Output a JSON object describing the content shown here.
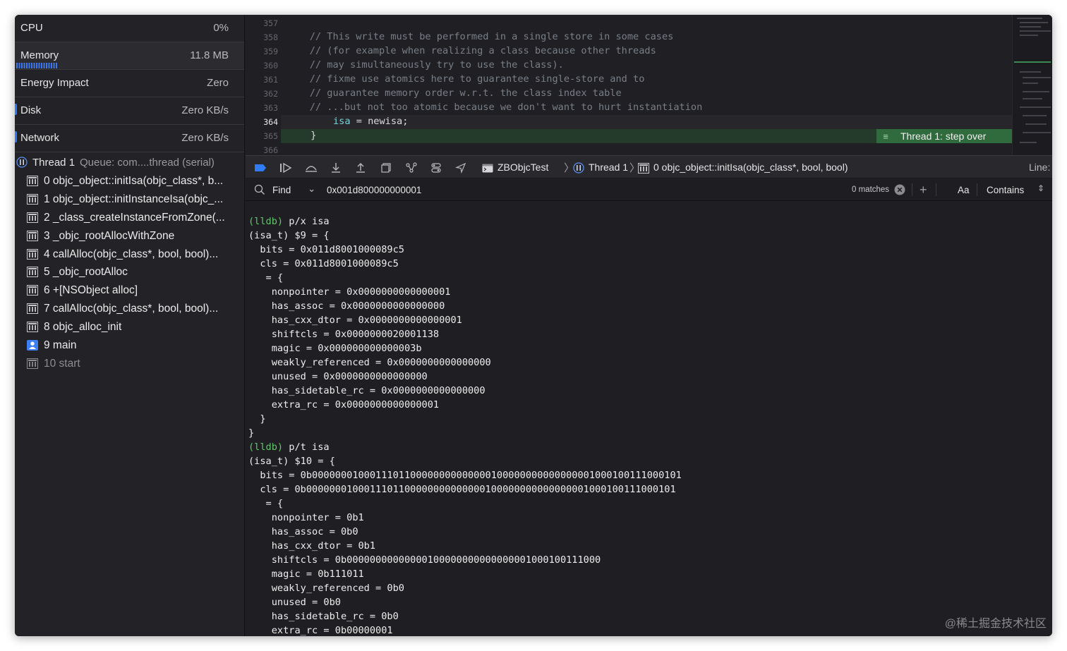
{
  "gauges": [
    {
      "label": "CPU",
      "value": "0%"
    },
    {
      "label": "Memory",
      "value": "11.8 MB"
    },
    {
      "label": "Energy Impact",
      "value": "Zero"
    },
    {
      "label": "Disk",
      "value": "Zero KB/s"
    },
    {
      "label": "Network",
      "value": "Zero KB/s"
    }
  ],
  "thread": {
    "name": "Thread 1",
    "queue": "Queue: com....thread (serial)"
  },
  "frames": [
    {
      "label": "0 objc_object::initIsa(objc_class*, b...",
      "icon": "library-icon"
    },
    {
      "label": "1 objc_object::initInstanceIsa(objc_...",
      "icon": "library-icon"
    },
    {
      "label": "2 _class_createInstanceFromZone(...",
      "icon": "library-icon"
    },
    {
      "label": "3 _objc_rootAllocWithZone",
      "icon": "library-icon"
    },
    {
      "label": "4 callAlloc(objc_class*, bool, bool)...",
      "icon": "library-icon"
    },
    {
      "label": "5 _objc_rootAlloc",
      "icon": "library-icon"
    },
    {
      "label": "6 +[NSObject alloc]",
      "icon": "library-icon"
    },
    {
      "label": "7 callAlloc(objc_class*, bool, bool)...",
      "icon": "library-icon"
    },
    {
      "label": "8 objc_alloc_init",
      "icon": "library-icon"
    },
    {
      "label": "9 main",
      "icon": "user-icon"
    },
    {
      "label": "10 start",
      "icon": "library-icon"
    }
  ],
  "editor": {
    "line_numbers": [
      "357",
      "358",
      "359",
      "360",
      "361",
      "362",
      "363",
      "364",
      "365",
      "366"
    ],
    "lines": [
      "",
      "    // This write must be performed in a single store in some cases",
      "    // (for example when realizing a class because other threads",
      "    // may simultaneously try to use the class).",
      "    // fixme use atomics here to guarantee single-store and to",
      "    // guarantee memory order w.r.t. the class index table",
      "    // ...but not too atomic because we don't want to hurt instantiation",
      "",
      " }",
      ""
    ],
    "line_364_var": "isa",
    "line_364_rest": " = newisa;",
    "step_badge": "Thread 1: step over"
  },
  "debugbar": {
    "target": "ZBObjcTest",
    "thread": "Thread 1",
    "frame": "0 objc_object::initIsa(objc_class*, bool, bool)",
    "line_label": "Line:"
  },
  "findbar": {
    "mode": "Find",
    "query": "0x001d800000000001",
    "matches": "0 matches",
    "case_label": "Aa",
    "match_type": "Contains"
  },
  "console": {
    "lines": [
      {
        "prompt": "(lldb)",
        "text": " p/x isa"
      },
      {
        "text": "(isa_t) $9 = {"
      },
      {
        "text": "  bits = 0x011d8001000089c5"
      },
      {
        "text": "  cls = 0x011d8001000089c5"
      },
      {
        "text": "   = {"
      },
      {
        "text": "    nonpointer = 0x0000000000000001"
      },
      {
        "text": "    has_assoc = 0x0000000000000000"
      },
      {
        "text": "    has_cxx_dtor = 0x0000000000000001"
      },
      {
        "text": "    shiftcls = 0x0000000020001138"
      },
      {
        "text": "    magic = 0x000000000000003b"
      },
      {
        "text": "    weakly_referenced = 0x0000000000000000"
      },
      {
        "text": "    unused = 0x0000000000000000"
      },
      {
        "text": "    has_sidetable_rc = 0x0000000000000000"
      },
      {
        "text": "    extra_rc = 0x0000000000000001"
      },
      {
        "text": "  }"
      },
      {
        "text": "}"
      },
      {
        "prompt": "(lldb)",
        "text": " p/t isa"
      },
      {
        "text": "(isa_t) $10 = {"
      },
      {
        "text": "  bits = 0b0000000100011101100000000000000100000000000000001000100111000101"
      },
      {
        "text": "  cls = 0b0000000100011101100000000000000100000000000000001000100111000101"
      },
      {
        "text": "   = {"
      },
      {
        "text": "    nonpointer = 0b1"
      },
      {
        "text": "    has_assoc = 0b0"
      },
      {
        "text": "    has_cxx_dtor = 0b1"
      },
      {
        "text": "    shiftcls = 0b00000000000000100000000000000001000100111000"
      },
      {
        "text": "    magic = 0b111011"
      },
      {
        "text": "    weakly_referenced = 0b0"
      },
      {
        "text": "    unused = 0b0"
      },
      {
        "text": "    has_sidetable_rc = 0b0"
      },
      {
        "text": "    extra_rc = 0b00000001"
      },
      {
        "text": "  }"
      }
    ]
  },
  "watermark": "@稀土掘金技术社区"
}
